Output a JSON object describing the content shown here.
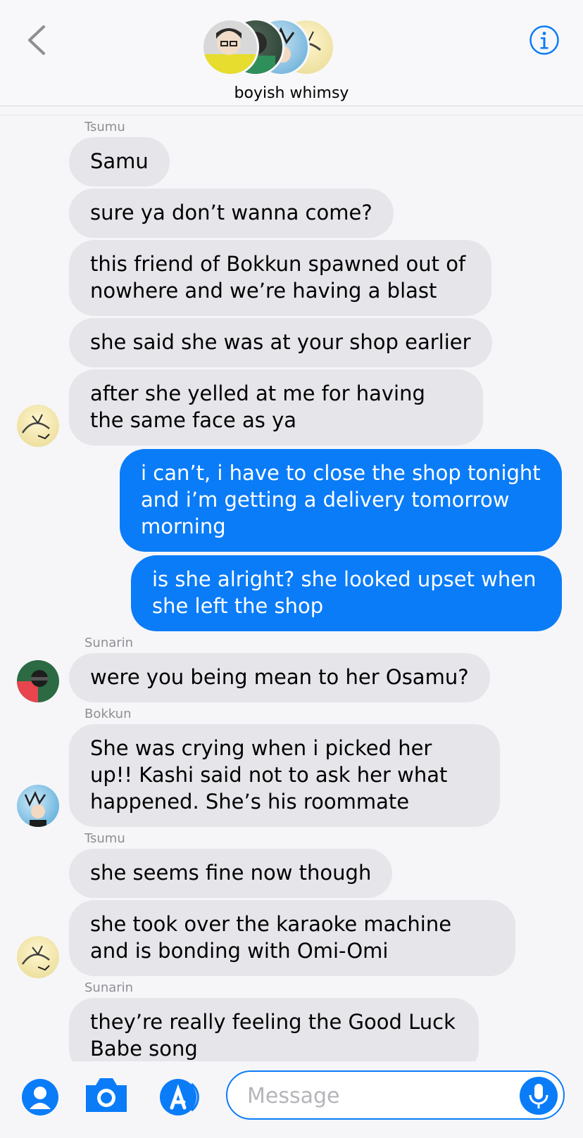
{
  "header": {
    "group_name": "boyish whimsy",
    "accent_color": "#0a7cf8"
  },
  "messages": [
    {
      "sender": "Tsumu",
      "text": "Samu"
    },
    {
      "text": "sure ya don’t wanna come?"
    },
    {
      "text": "this friend of Bokkun spawned out of nowhere and we’re having a blast"
    },
    {
      "text": "she said she was at your shop earlier"
    },
    {
      "text": "after she yelled at me for having the same face as ya"
    },
    {
      "text": "i can’t, i have to close the shop tonight and i’m getting a delivery tomorrow morning"
    },
    {
      "text": "is she alright? she looked upset when she left the shop"
    },
    {
      "sender": "Sunarin",
      "text": "were you being mean to her Osamu?"
    },
    {
      "sender": "Bokkun",
      "text": "She was crying when i picked her up!! Kashi said not to ask her what happened. She’s his roommate"
    },
    {
      "sender": "Tsumu",
      "text": "she seems fine now though"
    },
    {
      "text": "she took over the karaoke machine and is bonding with Omi-Omi"
    },
    {
      "sender": "Sunarin",
      "text": "they’re really feeling the Good Luck Babe song"
    }
  ],
  "input": {
    "placeholder": "Message"
  },
  "icons": [
    "back-chevron-icon",
    "info-icon",
    "contact-icon",
    "camera-icon",
    "app-store-icon",
    "microphone-icon"
  ]
}
